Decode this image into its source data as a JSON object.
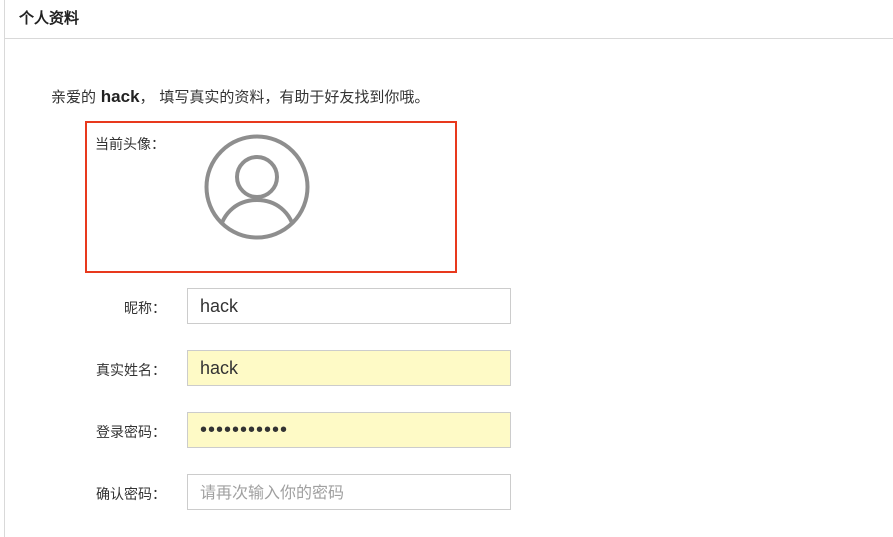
{
  "panel": {
    "title": "个人资料"
  },
  "greeting": {
    "prefix": "亲爱的",
    "username": "hack",
    "suffix": "， 填写真实的资料，有助于好友找到你哦。"
  },
  "avatar": {
    "label": "当前头像：",
    "icon": "user-avatar-icon",
    "frame_color": "#e8391d"
  },
  "form": {
    "nickname": {
      "label": "昵称：",
      "value": "hack"
    },
    "realname": {
      "label": "真实姓名：",
      "value": "hack"
    },
    "password": {
      "label": "登录密码：",
      "value": "hackhackhac"
    },
    "confirm_password": {
      "label": "确认密码：",
      "value": "",
      "placeholder": "请再次输入你的密码"
    }
  },
  "colors": {
    "autofill_background": "#fefac6",
    "border": "#cccccc",
    "highlight_border": "#e8391d"
  }
}
